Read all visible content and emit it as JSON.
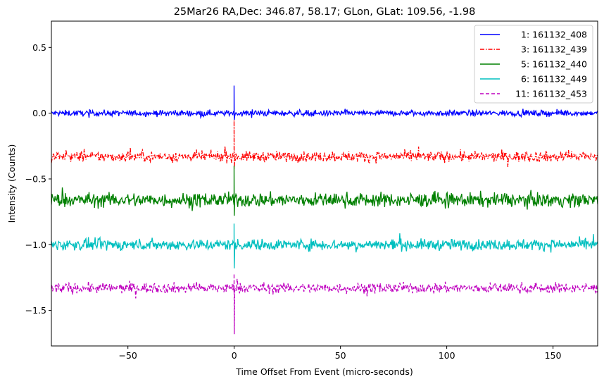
{
  "chart_data": {
    "type": "line",
    "title": "25Mar26 RA,Dec:  346.87,  58.17; GLon, GLat:  109.56,  -1.98",
    "xlabel": "Time Offset From Event (micro-seconds)",
    "ylabel": "Intensity (Counts)",
    "xlim": [
      -86,
      171
    ],
    "ylim": [
      -1.77,
      0.7
    ],
    "xticks": [
      -50,
      0,
      50,
      100,
      150
    ],
    "xtick_labels": [
      "−50",
      "0",
      "50",
      "100",
      "150"
    ],
    "yticks": [
      0.5,
      0.0,
      -0.5,
      -1.0,
      -1.5
    ],
    "ytick_labels": [
      "0.5",
      "0.0",
      "−0.5",
      "−1.0",
      "−1.5"
    ],
    "grid": false,
    "legend_position": "top-right",
    "series": [
      {
        "name": "1: 161132_408",
        "color": "#0000ff",
        "linestyle": "solid",
        "baseline": 0.0,
        "noise": 0.016,
        "event_peak": 0.21,
        "event_trough": -0.05
      },
      {
        "name": "3: 161132_439",
        "color": "#ff0000",
        "linestyle": "dashdot",
        "baseline": -0.33,
        "noise": 0.028,
        "event_peak": -0.05,
        "event_trough": -0.42
      },
      {
        "name": "5: 161132_440",
        "color": "#008000",
        "linestyle": "solid",
        "baseline": -0.66,
        "noise": 0.038,
        "event_peak": -0.4,
        "event_trough": -0.78
      },
      {
        "name": "6: 161132_449",
        "color": "#00bfbf",
        "linestyle": "solid",
        "baseline": -1.0,
        "noise": 0.03,
        "event_peak": -0.84,
        "event_trough": -1.18
      },
      {
        "name": "11: 161132_453",
        "color": "#bf00bf",
        "linestyle": "dashed",
        "baseline": -1.33,
        "noise": 0.028,
        "event_peak": -1.22,
        "event_trough": -1.68
      }
    ]
  }
}
